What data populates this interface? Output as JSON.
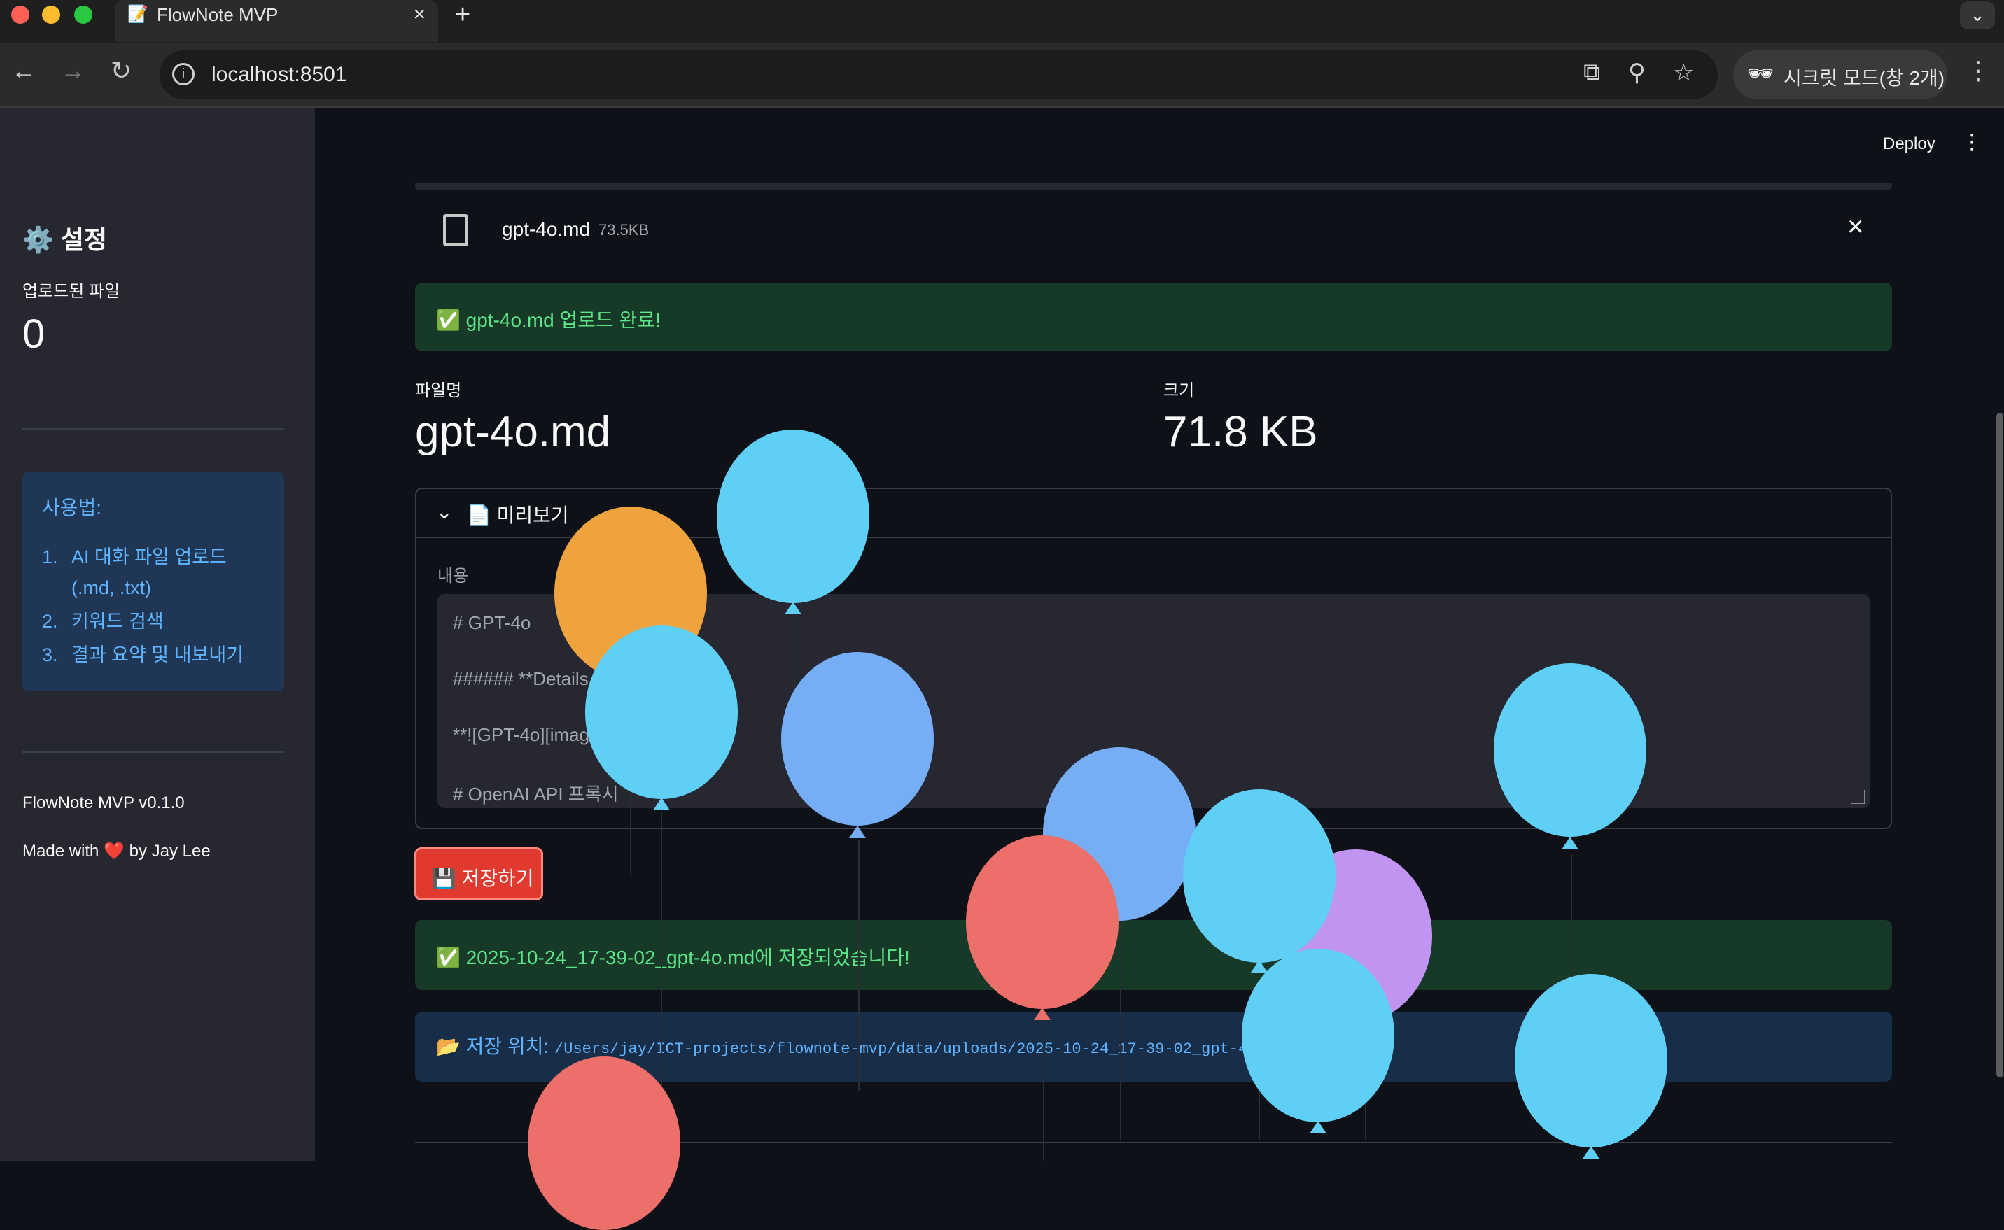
{
  "browser": {
    "tab_title": "FlowNote MVP",
    "tab_favicon": "📝",
    "new_tab": "+",
    "url": "localhost:8501",
    "incognito_label": "시크릿 모드(창 2개)",
    "icons": [
      "back-arrow-icon",
      "forward-arrow-icon",
      "reload-icon",
      "info-icon",
      "translate-icon",
      "zoom-icon",
      "star-icon",
      "incognito-icon",
      "menu-dots-icon"
    ]
  },
  "sidebar": {
    "title": "⚙️ 설정",
    "metric_label": "업로드된 파일",
    "metric_value": "0",
    "howto_title": "사용법:",
    "howto_items": [
      {
        "num": "1.",
        "line1": "AI 대화 파일 업로드",
        "line2": "(.md, .txt)"
      },
      {
        "num": "2.",
        "line1": "키워드 검색"
      },
      {
        "num": "3.",
        "line1": "결과 요약 및 내보내기"
      }
    ],
    "version": "FlowNote MVP v0.1.0",
    "made_with": "Made with ❤️ by Jay Lee"
  },
  "header": {
    "deploy_label": "Deploy",
    "menu_icon": "⋮"
  },
  "uploader": {
    "file_name": "gpt-4o.md",
    "file_size": "73.5KB"
  },
  "upload_success": "✅ gpt-4o.md 업로드 완료!",
  "metrics": {
    "filename_label": "파일명",
    "filename_value": "gpt-4o.md",
    "size_label": "크기",
    "size_value": "71.8 KB"
  },
  "preview": {
    "title": "📄 미리보기",
    "content_label": "내용",
    "lines": [
      "# GPT-4o",
      "###### **Details",
      "**![GPT-4o][imag",
      "# OpenAI API 프록시"
    ]
  },
  "save_button": "💾 저장하기",
  "save_success": "✅ 2025-10-24_17-39-02_gpt-4o.md에 저장되었습니다!",
  "save_location": {
    "label": "📂 저장 위치:",
    "path": "/Users/jay/ICT-projects/flownote-mvp/data/uploads/2025-10-24_17-39-02_gpt-4o.m"
  },
  "colors": {
    "accent": "#ff4b4b",
    "success_bg": "#173928",
    "success_text": "#5ce488",
    "info_bg": "#172d48",
    "info_text": "#60b4ff",
    "balloon_cyan": "#5fcff5",
    "balloon_blue": "#75aef5",
    "balloon_orange": "#eea33e",
    "balloon_red": "#ec6f6a",
    "balloon_purple": "#c094f0"
  }
}
